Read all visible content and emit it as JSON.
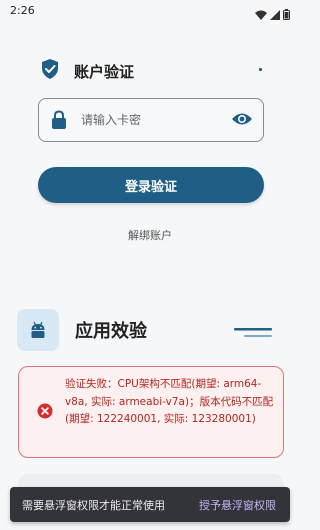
{
  "status_bar": {
    "time": "2:26",
    "icons": [
      "wifi-icon",
      "signal-icon",
      "battery-icon"
    ]
  },
  "auth": {
    "title": "账户验证",
    "icon": "shield-check-icon",
    "input": {
      "placeholder": "请输入卡密",
      "value": ""
    },
    "login_label": "登录验证",
    "unbind_label": "解绑账户"
  },
  "app_verify": {
    "title": "应用效验",
    "icon": "android-icon",
    "error": {
      "icon": "error-circle-icon",
      "message": "验证失败：CPU架构不匹配(期望: arm64-v8a, 实际: armeabi-v7a)；版本代码不匹配(期望: 122240001, 实际: 123280001)"
    }
  },
  "snackbar": {
    "message": "需要悬浮窗权限才能正常使用",
    "action": "授予悬浮窗权限"
  },
  "colors": {
    "primary": "#1f5f86",
    "error": "#b3261e",
    "error_bg": "#fdf0f0",
    "error_border": "#e57373",
    "snackbar_bg": "#33343a",
    "snackbar_action": "#c4b5f4",
    "icon_box_bg": "#d9e8f5"
  }
}
